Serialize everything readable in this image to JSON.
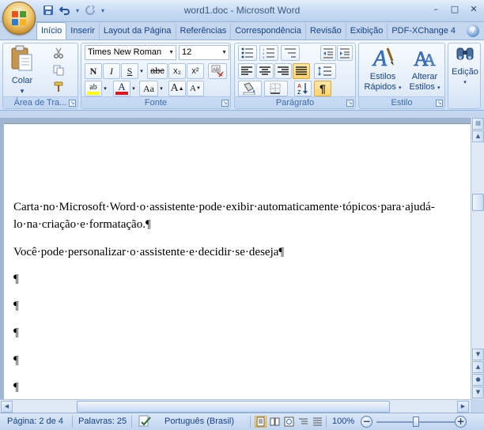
{
  "window": {
    "title": "word1.doc - Microsoft Word",
    "minimize": "–",
    "maximize": "□",
    "close": "✕"
  },
  "qat": {
    "save_icon": "save-icon",
    "undo_icon": "undo-icon",
    "redo_icon": "redo-icon",
    "customize_icon": "customize-qat-icon"
  },
  "tabs": [
    {
      "label": "Início",
      "active": true
    },
    {
      "label": "Inserir"
    },
    {
      "label": "Layout da Página"
    },
    {
      "label": "Referências"
    },
    {
      "label": "Correspondência"
    },
    {
      "label": "Revisão"
    },
    {
      "label": "Exibição"
    },
    {
      "label": "PDF-XChange 4"
    }
  ],
  "ribbon": {
    "clipboard": {
      "label": "Área de Tra...",
      "paste_label": "Colar",
      "paste_arrow": "▾"
    },
    "font": {
      "label": "Fonte",
      "font_name": "Times New Roman",
      "font_size": "12",
      "bold": "N",
      "italic": "I",
      "underline": "S",
      "strike": "abc",
      "subscript": "x₂",
      "superscript": "x²",
      "grow": "A",
      "shrink": "A",
      "case": "Aa",
      "highlight": "ab",
      "font_color": "A",
      "highlight_color": "#ffff00",
      "font_color_swatch": "#e0141e"
    },
    "paragraph": {
      "label": "Parágrafo",
      "pilcrow": "¶",
      "sort": "A↓Z"
    },
    "styles": {
      "label": "Estilo",
      "quick_styles_line1": "Estilos",
      "quick_styles_line2": "Rápidos",
      "change_styles_line1": "Alterar",
      "change_styles_line2": "Estilos"
    },
    "editing": {
      "label": "Edição"
    }
  },
  "document": {
    "lines": [
      "Carta·no·Microsoft·Word·o·assistente·pode·exibir·automaticamente·tópicos·para·ajudá-",
      "lo·na·criação·e·formatação.¶",
      "Você·pode·personalizar·o·assistente·e·decidir·se·deseja¶",
      "¶",
      "¶",
      "¶",
      "¶",
      "¶"
    ]
  },
  "status": {
    "page": "Página: 2 de 4",
    "words": "Palavras: 25",
    "language": "Português (Brasil)",
    "zoom": "100%",
    "zoom_level": 0.5,
    "active_view": "print-layout"
  },
  "colors": {
    "accent": "#15428b",
    "ribbon_bg": "#dbe8f8",
    "selected_btn": "#ffd36a"
  }
}
